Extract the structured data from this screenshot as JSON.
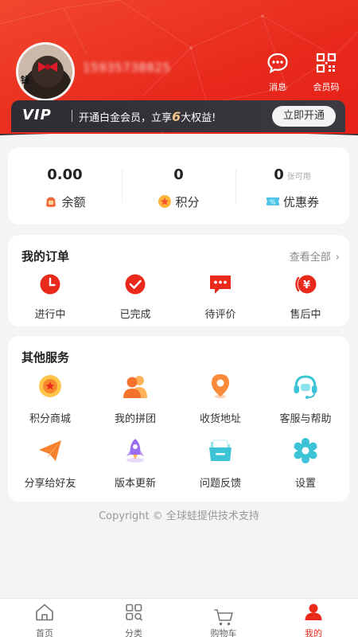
{
  "profile": {
    "phone": "15935738825",
    "actions": [
      {
        "label": "消息",
        "icon": "message-icon"
      },
      {
        "label": "会员码",
        "icon": "qr-code-icon"
      }
    ]
  },
  "vip": {
    "logo": "VIP",
    "text_before": "开通白金会员，立享",
    "count": "6",
    "text_after": "大权益!",
    "button": "立即开通"
  },
  "stats": [
    {
      "value": "0.00",
      "label": "余额",
      "icon": "wallet-icon"
    },
    {
      "value": "0",
      "label": "积分",
      "icon": "points-icon"
    },
    {
      "value": "0",
      "sub": "张可用",
      "label": "优惠券",
      "icon": "coupon-icon"
    }
  ],
  "orders": {
    "title": "我的订单",
    "view_all": "查看全部",
    "items": [
      {
        "label": "进行中",
        "icon": "clock-icon"
      },
      {
        "label": "已完成",
        "icon": "check-icon"
      },
      {
        "label": "待评价",
        "icon": "comment-icon"
      },
      {
        "label": "售后中",
        "icon": "refund-icon"
      }
    ]
  },
  "services": {
    "title": "其他服务",
    "items": [
      {
        "label": "积分商城",
        "icon": "points-mall-icon"
      },
      {
        "label": "我的拼团",
        "icon": "group-buy-icon"
      },
      {
        "label": "收货地址",
        "icon": "location-icon"
      },
      {
        "label": "客服与帮助",
        "icon": "headset-icon"
      },
      {
        "label": "分享给好友",
        "icon": "share-icon"
      },
      {
        "label": "版本更新",
        "icon": "rocket-icon"
      },
      {
        "label": "问题反馈",
        "icon": "feedback-icon"
      },
      {
        "label": "设置",
        "icon": "settings-icon"
      }
    ]
  },
  "copyright": "Copyright © 全球蛙提供技术支持",
  "tabs": [
    {
      "label": "首页",
      "icon": "home-icon"
    },
    {
      "label": "分类",
      "icon": "category-icon"
    },
    {
      "label": "购物车",
      "icon": "cart-icon"
    },
    {
      "label": "我的",
      "icon": "profile-icon",
      "active": true
    }
  ],
  "colors": {
    "brand": "#e8291c",
    "vip_bar": "#333136",
    "vip_accent": "#f2c389"
  }
}
